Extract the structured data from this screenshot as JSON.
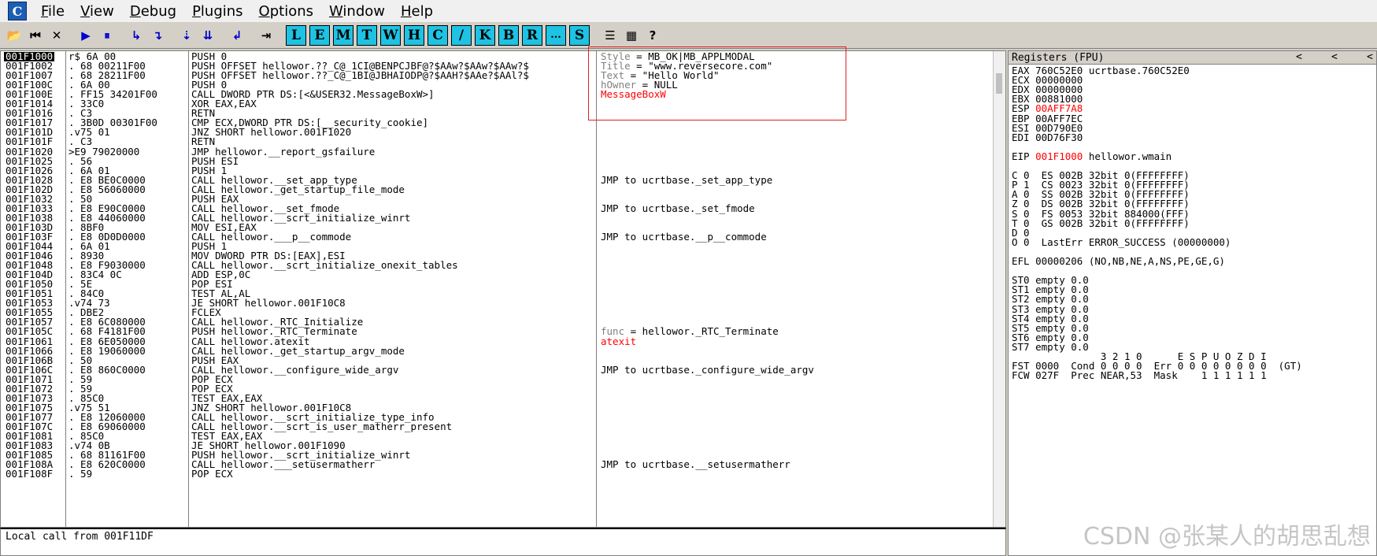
{
  "app": {
    "icon_letter": "C"
  },
  "menu": [
    {
      "label": "File",
      "ul": "F",
      "rest": "ile"
    },
    {
      "label": "View",
      "ul": "V",
      "rest": "iew"
    },
    {
      "label": "Debug",
      "ul": "D",
      "rest": "ebug"
    },
    {
      "label": "Plugins",
      "ul": "P",
      "rest": "lugins"
    },
    {
      "label": "Options",
      "ul": "O",
      "rest": "ptions"
    },
    {
      "label": "Window",
      "ul": "W",
      "rest": "indow"
    },
    {
      "label": "Help",
      "ul": "H",
      "rest": "elp"
    }
  ],
  "toolbar": {
    "buttons": [
      {
        "name": "open-icon",
        "glyph": "📂"
      },
      {
        "name": "restart-icon",
        "glyph": "⏮"
      },
      {
        "name": "close-icon",
        "glyph": "✕"
      },
      {
        "name": "run-icon",
        "glyph": "▶"
      },
      {
        "name": "pause-icon",
        "glyph": "⏸"
      },
      {
        "name": "step-into-icon",
        "glyph": "↳"
      },
      {
        "name": "step-over-icon",
        "glyph": "↴"
      },
      {
        "name": "trace-into-icon",
        "glyph": "⇣"
      },
      {
        "name": "trace-over-icon",
        "glyph": "⇊"
      },
      {
        "name": "execute-till-return-icon",
        "glyph": "↲"
      },
      {
        "name": "goto-icon",
        "glyph": "⇥"
      }
    ],
    "letters": [
      "L",
      "E",
      "M",
      "T",
      "W",
      "H",
      "C",
      "/",
      "K",
      "B",
      "R",
      "...",
      "S"
    ],
    "tail": [
      {
        "name": "list-icon",
        "glyph": "☰"
      },
      {
        "name": "grid-icon",
        "glyph": "▦"
      },
      {
        "name": "help-icon",
        "glyph": "?"
      }
    ]
  },
  "disassembly": {
    "rows": [
      {
        "addr": "001F1000",
        "hex": "r$ 6A 00",
        "asm": "PUSH 0",
        "cmt": "Style = MB_OK|MB_APPLMODAL",
        "cmt_style": "mixed"
      },
      {
        "addr": "001F1002",
        "hex": ". 68 00211F00",
        "asm": "PUSH OFFSET hellowor.??_C@_1CI@BENPCJBF@?$AAw?$AAw?$AAw?$",
        "cmt": "Title = \"www.reversecore.com\"",
        "cmt_style": "mixed"
      },
      {
        "addr": "001F1007",
        "hex": ". 68 28211F00",
        "asm": "PUSH OFFSET hellowor.??_C@_1BI@JBHAIODP@?$AAH?$AAe?$AAl?$",
        "cmt": "Text = \"Hello World\"",
        "cmt_style": "mixed"
      },
      {
        "addr": "001F100C",
        "hex": ". 6A 00",
        "asm": "PUSH 0",
        "cmt": "hOwner = NULL",
        "cmt_style": "mixed"
      },
      {
        "addr": "001F100E",
        "hex": ". FF15 34201F00",
        "asm": "CALL DWORD PTR DS:[<&USER32.MessageBoxW>]",
        "cmt": "MessageBoxW",
        "cmt_style": "red"
      },
      {
        "addr": "001F1014",
        "hex": ". 33C0",
        "asm": "XOR EAX,EAX",
        "cmt": "",
        "cmt_style": ""
      },
      {
        "addr": "001F1016",
        "hex": ". C3",
        "asm": "RETN",
        "cmt": "",
        "cmt_style": ""
      },
      {
        "addr": "001F1017",
        "hex": ". 3B0D 00301F00",
        "asm": "CMP ECX,DWORD PTR DS:[__security_cookie]",
        "cmt": "",
        "cmt_style": ""
      },
      {
        "addr": "001F101D",
        "hex": ".v75 01",
        "asm": "JNZ SHORT hellowor.001F1020",
        "cmt": "",
        "cmt_style": ""
      },
      {
        "addr": "001F101F",
        "hex": ". C3",
        "asm": "RETN",
        "cmt": "",
        "cmt_style": ""
      },
      {
        "addr": "001F1020",
        "hex": ">E9 79020000",
        "asm": "JMP hellowor.__report_gsfailure",
        "cmt": "",
        "cmt_style": ""
      },
      {
        "addr": "001F1025",
        "hex": ". 56",
        "asm": "PUSH ESI",
        "cmt": "",
        "cmt_style": ""
      },
      {
        "addr": "001F1026",
        "hex": ". 6A 01",
        "asm": "PUSH 1",
        "cmt": "",
        "cmt_style": ""
      },
      {
        "addr": "001F1028",
        "hex": ". E8 BE0C0000",
        "asm": "CALL hellowor.__set_app_type",
        "cmt": "JMP to ucrtbase._set_app_type",
        "cmt_style": "plain"
      },
      {
        "addr": "001F102D",
        "hex": ". E8 56060000",
        "asm": "CALL hellowor._get_startup_file_mode",
        "cmt": "",
        "cmt_style": ""
      },
      {
        "addr": "001F1032",
        "hex": ". 50",
        "asm": "PUSH EAX",
        "cmt": "",
        "cmt_style": ""
      },
      {
        "addr": "001F1033",
        "hex": ". E8 E90C0000",
        "asm": "CALL hellowor.__set_fmode",
        "cmt": "JMP to ucrtbase._set_fmode",
        "cmt_style": "plain"
      },
      {
        "addr": "001F1038",
        "hex": ". E8 44060000",
        "asm": "CALL hellowor.__scrt_initialize_winrt",
        "cmt": "",
        "cmt_style": ""
      },
      {
        "addr": "001F103D",
        "hex": ". 8BF0",
        "asm": "MOV ESI,EAX",
        "cmt": "",
        "cmt_style": ""
      },
      {
        "addr": "001F103F",
        "hex": ". E8 0D0D0000",
        "asm": "CALL hellowor.___p__commode",
        "cmt": "JMP to ucrtbase.__p__commode",
        "cmt_style": "plain"
      },
      {
        "addr": "001F1044",
        "hex": ". 6A 01",
        "asm": "PUSH 1",
        "cmt": "",
        "cmt_style": ""
      },
      {
        "addr": "001F1046",
        "hex": ". 8930",
        "asm": "MOV DWORD PTR DS:[EAX],ESI",
        "cmt": "",
        "cmt_style": ""
      },
      {
        "addr": "001F1048",
        "hex": ". E8 F9030000",
        "asm": "CALL hellowor.__scrt_initialize_onexit_tables",
        "cmt": "",
        "cmt_style": ""
      },
      {
        "addr": "001F104D",
        "hex": ". 83C4 0C",
        "asm": "ADD ESP,0C",
        "cmt": "",
        "cmt_style": ""
      },
      {
        "addr": "001F1050",
        "hex": ". 5E",
        "asm": "POP ESI",
        "cmt": "",
        "cmt_style": ""
      },
      {
        "addr": "001F1051",
        "hex": ". 84C0",
        "asm": "TEST AL,AL",
        "cmt": "",
        "cmt_style": ""
      },
      {
        "addr": "001F1053",
        "hex": ".v74 73",
        "asm": "JE SHORT hellowor.001F10C8",
        "cmt": "",
        "cmt_style": ""
      },
      {
        "addr": "001F1055",
        "hex": ". DBE2",
        "asm": "FCLEX",
        "cmt": "",
        "cmt_style": ""
      },
      {
        "addr": "001F1057",
        "hex": ". E8 6C080000",
        "asm": "CALL hellowor._RTC_Initialize",
        "cmt": "",
        "cmt_style": ""
      },
      {
        "addr": "001F105C",
        "hex": ". 68 F4181F00",
        "asm": "PUSH hellowor._RTC_Terminate",
        "cmt": "func = hellowor._RTC_Terminate",
        "cmt_style": "mixed"
      },
      {
        "addr": "001F1061",
        "hex": ". E8 6E050000",
        "asm": "CALL hellowor.atexit",
        "cmt": "atexit",
        "cmt_style": "red"
      },
      {
        "addr": "001F1066",
        "hex": ". E8 19060000",
        "asm": "CALL hellowor._get_startup_argv_mode",
        "cmt": "",
        "cmt_style": ""
      },
      {
        "addr": "001F106B",
        "hex": ". 50",
        "asm": "PUSH EAX",
        "cmt": "",
        "cmt_style": ""
      },
      {
        "addr": "001F106C",
        "hex": ". E8 860C0000",
        "asm": "CALL hellowor.__configure_wide_argv",
        "cmt": "JMP to ucrtbase._configure_wide_argv",
        "cmt_style": "plain"
      },
      {
        "addr": "001F1071",
        "hex": ". 59",
        "asm": "POP ECX",
        "cmt": "",
        "cmt_style": ""
      },
      {
        "addr": "001F1072",
        "hex": ". 59",
        "asm": "POP ECX",
        "cmt": "",
        "cmt_style": ""
      },
      {
        "addr": "001F1073",
        "hex": ". 85C0",
        "asm": "TEST EAX,EAX",
        "cmt": "",
        "cmt_style": ""
      },
      {
        "addr": "001F1075",
        "hex": ".v75 51",
        "asm": "JNZ SHORT hellowor.001F10C8",
        "cmt": "",
        "cmt_style": ""
      },
      {
        "addr": "001F1077",
        "hex": ". E8 12060000",
        "asm": "CALL hellowor.__scrt_initialize_type_info",
        "cmt": "",
        "cmt_style": ""
      },
      {
        "addr": "001F107C",
        "hex": ". E8 69060000",
        "asm": "CALL hellowor.__scrt_is_user_matherr_present",
        "cmt": "",
        "cmt_style": ""
      },
      {
        "addr": "001F1081",
        "hex": ". 85C0",
        "asm": "TEST EAX,EAX",
        "cmt": "",
        "cmt_style": ""
      },
      {
        "addr": "001F1083",
        "hex": ".v74 0B",
        "asm": "JE SHORT hellowor.001F1090",
        "cmt": "",
        "cmt_style": ""
      },
      {
        "addr": "001F1085",
        "hex": ". 68 81161F00",
        "asm": "PUSH hellowor.__scrt_initialize_winrt",
        "cmt": "",
        "cmt_style": ""
      },
      {
        "addr": "001F108A",
        "hex": ". E8 620C0000",
        "asm": "CALL hellowor.___setusermatherr",
        "cmt": "JMP to ucrtbase.__setusermatherr",
        "cmt_style": "plain"
      },
      {
        "addr": "001F108F",
        "hex": ". 59",
        "asm": "POP ECX",
        "cmt": "",
        "cmt_style": ""
      }
    ],
    "comment_labels": {
      "style": "Style",
      "title": "Title",
      "text": "Text",
      "howner": "hOwner",
      "func": "func"
    }
  },
  "info_line": "Local call from 001F11DF",
  "registers": {
    "title": "Registers (FPU)",
    "lines": [
      {
        "t": "EAX 760C52E0 ucrtbase.760C52E0"
      },
      {
        "t": "ECX 00000000"
      },
      {
        "t": "EDX 00000000"
      },
      {
        "t": "EBX 00881000"
      },
      {
        "t": "ESP ",
        "red": "00AFF7A8"
      },
      {
        "t": "EBP 00AFF7EC"
      },
      {
        "t": "ESI 00D790E0"
      },
      {
        "t": "EDI 00D76F30"
      },
      {
        "t": ""
      },
      {
        "t": "EIP ",
        "red": "001F1000",
        "after": " hellowor.wmain"
      },
      {
        "t": ""
      },
      {
        "t": "C 0  ES 002B 32bit 0(FFFFFFFF)"
      },
      {
        "t": "P 1  CS 0023 32bit 0(FFFFFFFF)"
      },
      {
        "t": "A 0  SS 002B 32bit 0(FFFFFFFF)"
      },
      {
        "t": "Z 0  DS 002B 32bit 0(FFFFFFFF)"
      },
      {
        "t": "S 0  FS 0053 32bit 884000(FFF)"
      },
      {
        "t": "T 0  GS 002B 32bit 0(FFFFFFFF)"
      },
      {
        "t": "D 0"
      },
      {
        "t": "O 0  LastErr ERROR_SUCCESS (00000000)"
      },
      {
        "t": ""
      },
      {
        "t": "EFL 00000206 (NO,NB,NE,A,NS,PE,GE,G)"
      },
      {
        "t": ""
      },
      {
        "t": "ST0 empty 0.0"
      },
      {
        "t": "ST1 empty 0.0"
      },
      {
        "t": "ST2 empty 0.0"
      },
      {
        "t": "ST3 empty 0.0"
      },
      {
        "t": "ST4 empty 0.0"
      },
      {
        "t": "ST5 empty 0.0"
      },
      {
        "t": "ST6 empty 0.0"
      },
      {
        "t": "ST7 empty 0.0"
      },
      {
        "t": "               3 2 1 0      E S P U O Z D I"
      },
      {
        "t": "FST 0000  Cond 0 0 0 0  Err 0 0 0 0 0 0 0 0  (GT)"
      },
      {
        "t": "FCW 027F  Prec NEAR,53  Mask    1 1 1 1 1 1"
      }
    ]
  },
  "watermark": "CSDN @张某人的胡思乱想"
}
